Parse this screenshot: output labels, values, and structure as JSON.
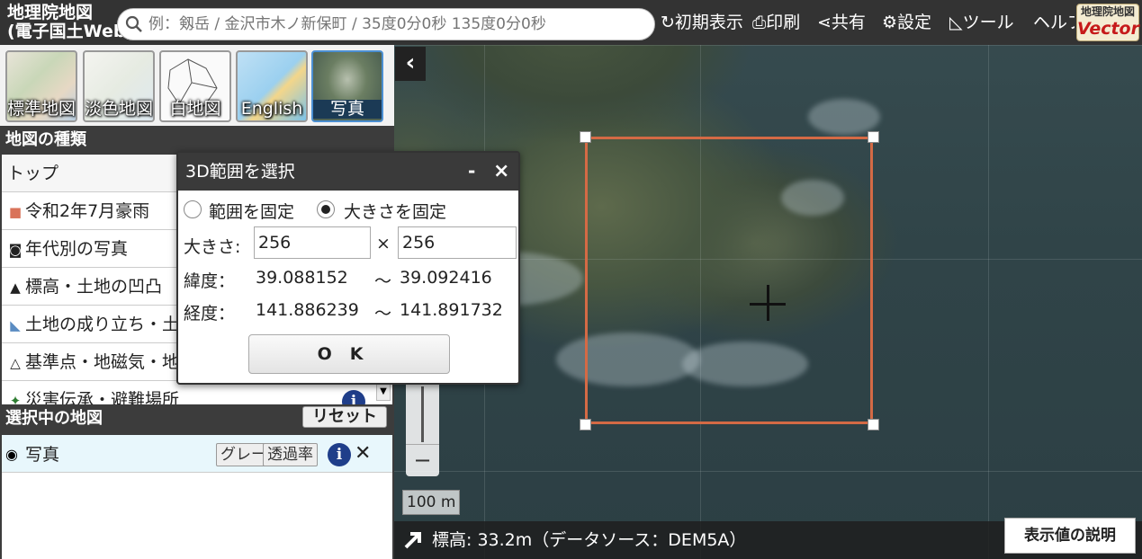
{
  "header": {
    "title_line1": "地理院地図",
    "title_line2": "(電子国土Web)",
    "search_placeholder": "例：剱岳 / 金沢市木ノ新保町 / 35度0分0秒 135度0分0秒",
    "buttons": {
      "reset_view": "初期表示",
      "print": "印刷",
      "share": "共有",
      "settings": "設定",
      "tools": "ツール",
      "help": "ヘルプ"
    },
    "vector_logo": {
      "line1": "地理院地図",
      "line2": "Vector"
    }
  },
  "base_maps": [
    {
      "label": "標準地図"
    },
    {
      "label": "淡色地図"
    },
    {
      "label": "白地図"
    },
    {
      "label": "English"
    },
    {
      "label": "写真"
    }
  ],
  "map_types": {
    "title": "地図の種類",
    "items": [
      {
        "label": "トップ",
        "icon": ""
      },
      {
        "label": "令和2年7月豪雨",
        "icon": "folder-icon"
      },
      {
        "label": "年代別の写真",
        "icon": "camera-icon"
      },
      {
        "label": "標高・土地の凹凸",
        "icon": "mountain-icon"
      },
      {
        "label": "土地の成り立ち・土地利用",
        "icon": "land-icon"
      },
      {
        "label": "基準点・地磁気・地殻変動",
        "icon": "triangle-point-icon"
      },
      {
        "label": "災害伝承・避難場所",
        "icon": "disaster-icon"
      }
    ]
  },
  "selected_maps": {
    "title": "選択中の地図",
    "reset_label": "リセット",
    "items": [
      {
        "name": "写真",
        "gray_label": "グレースケール",
        "opacity_label": "透過率"
      }
    ]
  },
  "dialog": {
    "title": "3D範囲を選択",
    "minimize": "-",
    "close": "×",
    "radio_fixed_range": "範囲を固定",
    "radio_fixed_size": "大きさを固定",
    "selected_mode": "fixed_size",
    "size_label": "大きさ:",
    "size_times": "×",
    "width": "256",
    "height": "256",
    "lat_label": "緯度：",
    "lat_from": "39.088152",
    "lat_tilde": "～",
    "lat_to": "39.092416",
    "lon_label": "経度：",
    "lon_from": "141.886239",
    "lon_tilde": "～",
    "lon_to": "141.891732",
    "ok_label": "OK"
  },
  "map": {
    "scale_label": "100 m",
    "elevation_text": "標高: 33.2m（データソース：DEM5A）",
    "explain_label": "表示値の説明",
    "colors": {
      "selection": "#d46a45",
      "topbar": "#333333",
      "info": "#1f3e8a"
    }
  }
}
